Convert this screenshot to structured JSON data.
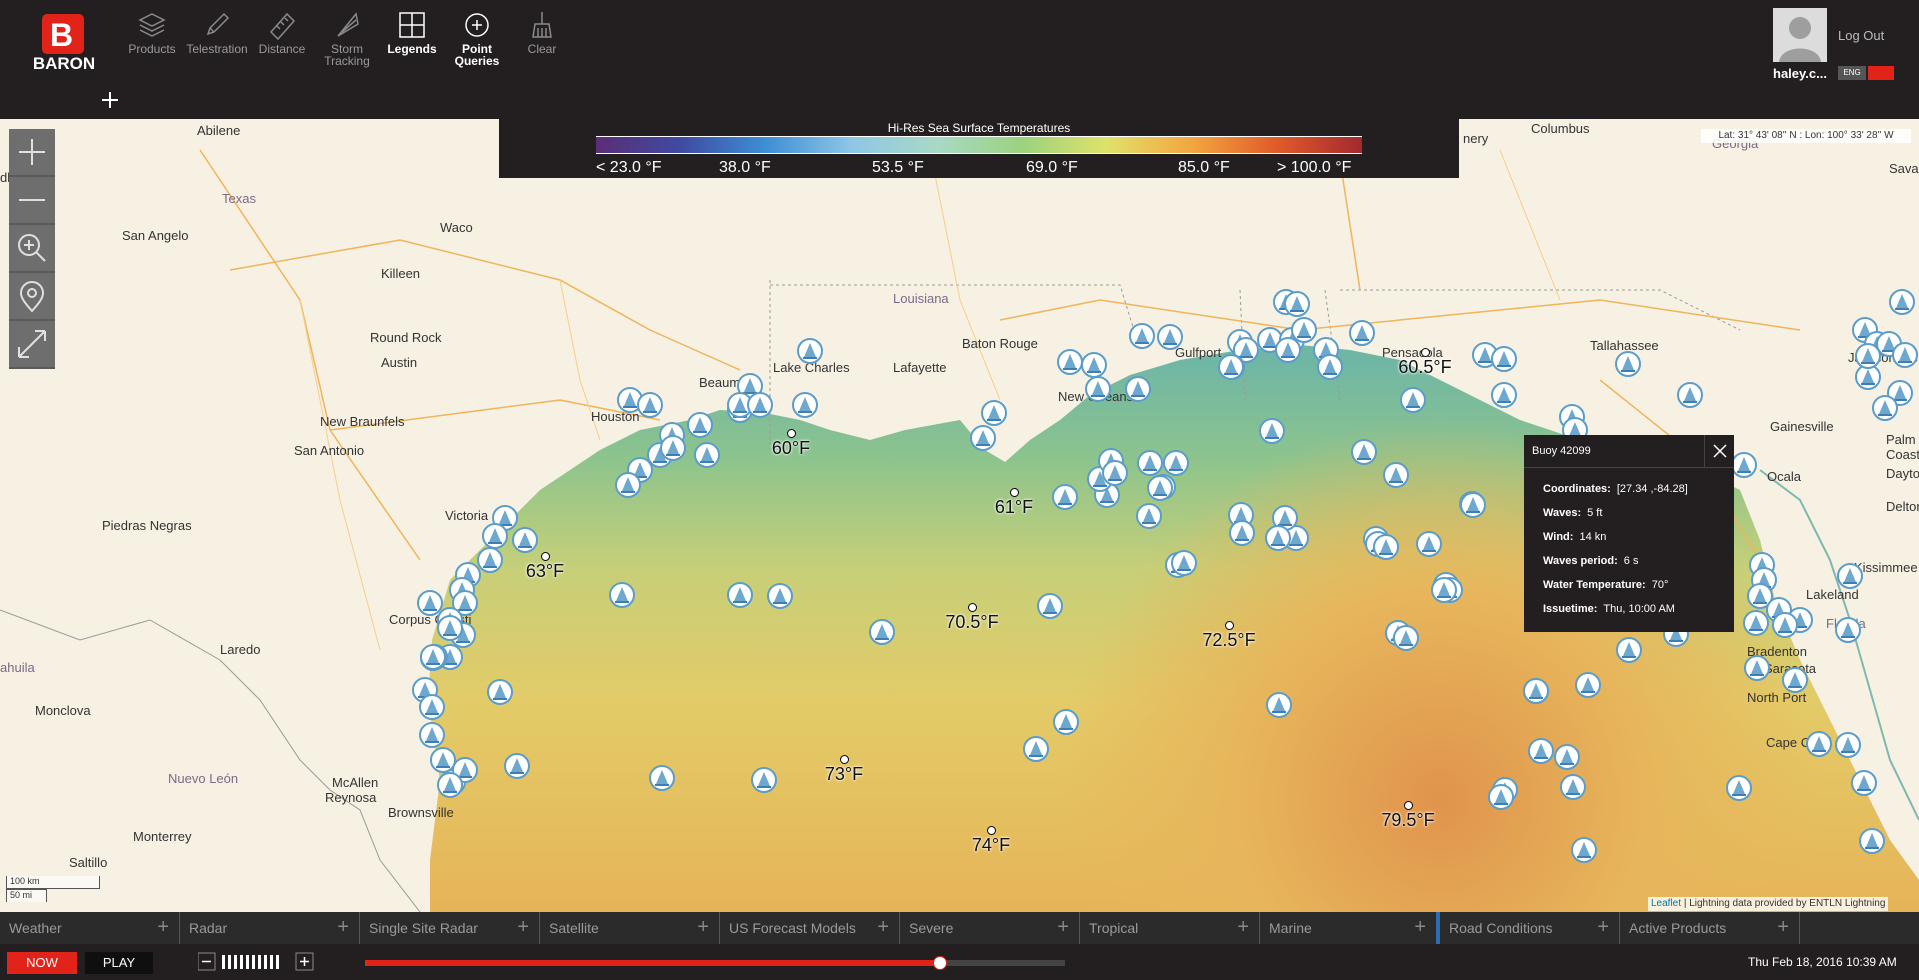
{
  "app": {
    "logo_text": "BARON"
  },
  "toolbar": [
    {
      "label": "Products",
      "icon": "layers-icon"
    },
    {
      "label": "Telestration",
      "icon": "pencil-icon"
    },
    {
      "label": "Distance",
      "icon": "ruler-icon"
    },
    {
      "label": "Storm Tracking",
      "icon": "storm-cone-icon"
    },
    {
      "label": "Legends",
      "icon": "grid-icon"
    },
    {
      "label": "Point Queries",
      "icon": "crosshair-icon"
    },
    {
      "label": "Clear",
      "icon": "broom-icon"
    }
  ],
  "user": {
    "name": "haley.c...",
    "logout_label": "Log Out",
    "lang": "ENG"
  },
  "legend": {
    "title": "Hi-Res Sea Surface Temperatures",
    "labels": [
      "< 23.0 °F",
      "38.0 °F",
      "53.5 °F",
      "69.0 °F",
      "85.0 °F",
      "> 100.0 °F"
    ]
  },
  "map": {
    "coords_readout": "Lat: 31° 43' 08'' N : Lon: 100° 33' 28'' W",
    "scale": {
      "km": "100 km",
      "mi": "50 mi"
    },
    "attribution_link": "Leaflet",
    "attribution_text": "| Lightning data provided by ENTLN Lightning",
    "place_labels": [
      "Abilene",
      "Texas",
      "San Angelo",
      "Waco",
      "Killeen",
      "Round Rock",
      "Austin",
      "New Braunfels",
      "San Antonio",
      "Victoria",
      "Piedras Negras",
      "Corpus Christi",
      "Laredo",
      "Monclova",
      "Nuevo León",
      "McAllen",
      "Reynosa",
      "Brownsville",
      "Monterrey",
      "Saltillo",
      "Louisiana",
      "Baton Rouge",
      "Lafayette",
      "Lake Charles",
      "Beaumont",
      "Houston",
      "New Orleans",
      "Gulfport",
      "Pensacola",
      "Tallahassee",
      "Columbus",
      "Georgia",
      "Savannah",
      "Jacksonville",
      "Gainesville",
      "Ocala",
      "Palm Coast",
      "Daytona",
      "Deltona",
      "Kissimmee",
      "Lakeland",
      "Bradenton",
      "Sarasota",
      "North Port",
      "Cape Coral",
      "Florida",
      "dland",
      "ahuila",
      "nery"
    ],
    "temp_labels": [
      "60°F",
      "61°F",
      "63°F",
      "70.5°F",
      "72.5°F",
      "60.5°F",
      "73°F",
      "74°F",
      "79.5°F"
    ]
  },
  "popup": {
    "title": "Buoy 42099",
    "coordinates_label": "Coordinates:",
    "coordinates": "[27.34 ,-84.28]",
    "waves_label": "Waves:",
    "waves": "5 ft",
    "wind_label": "Wind:",
    "wind": "14 kn",
    "wave_period_label": "Waves period:",
    "wave_period": "6 s",
    "water_temp_label": "Water Temperature:",
    "water_temp": "70°",
    "issuetime_label": "Issuetime:",
    "issuetime": "Thu, 10:00 AM"
  },
  "tabs": [
    "Weather",
    "Radar",
    "Single Site Radar",
    "Satellite",
    "US Forecast Models",
    "Severe",
    "Tropical",
    "Marine",
    "Road Conditions",
    "Active Products"
  ],
  "controls": {
    "now_label": "NOW",
    "play_label": "PLAY",
    "datetime": "Thu Feb 18, 2016 10:39 AM",
    "timeline_progress": 0.82
  },
  "colors": {
    "brand_red": "#e2231a",
    "dark_bg": "#231f20"
  }
}
